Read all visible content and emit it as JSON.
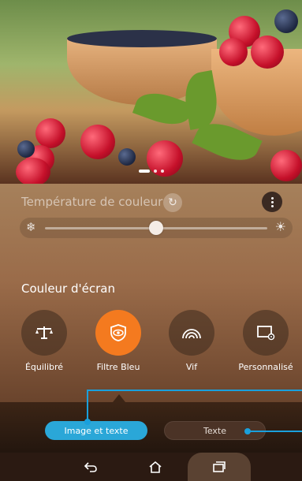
{
  "color_temperature": {
    "label": "Température de couleur",
    "slider_value_fraction": 0.5
  },
  "screen_color": {
    "title": "Couleur d'écran",
    "modes": [
      {
        "label": "Équilibré",
        "icon": "balance-scale-icon",
        "active": false
      },
      {
        "label": "Filtre Bleu",
        "icon": "eye-shield-icon",
        "active": true
      },
      {
        "label": "Vif",
        "icon": "rainbow-icon",
        "active": false
      },
      {
        "label": "Personnalisé",
        "icon": "custom-screen-icon",
        "active": false
      }
    ]
  },
  "tutorial": {
    "option_image_text": "Image et texte",
    "option_text": "Texte"
  },
  "navigation": {
    "back_icon": "back-arrow-icon",
    "home_icon": "home-icon",
    "recent_icon": "recent-apps-icon"
  },
  "colors": {
    "accent_orange": "#f47a1f",
    "accent_blue": "#2aa7d8"
  }
}
